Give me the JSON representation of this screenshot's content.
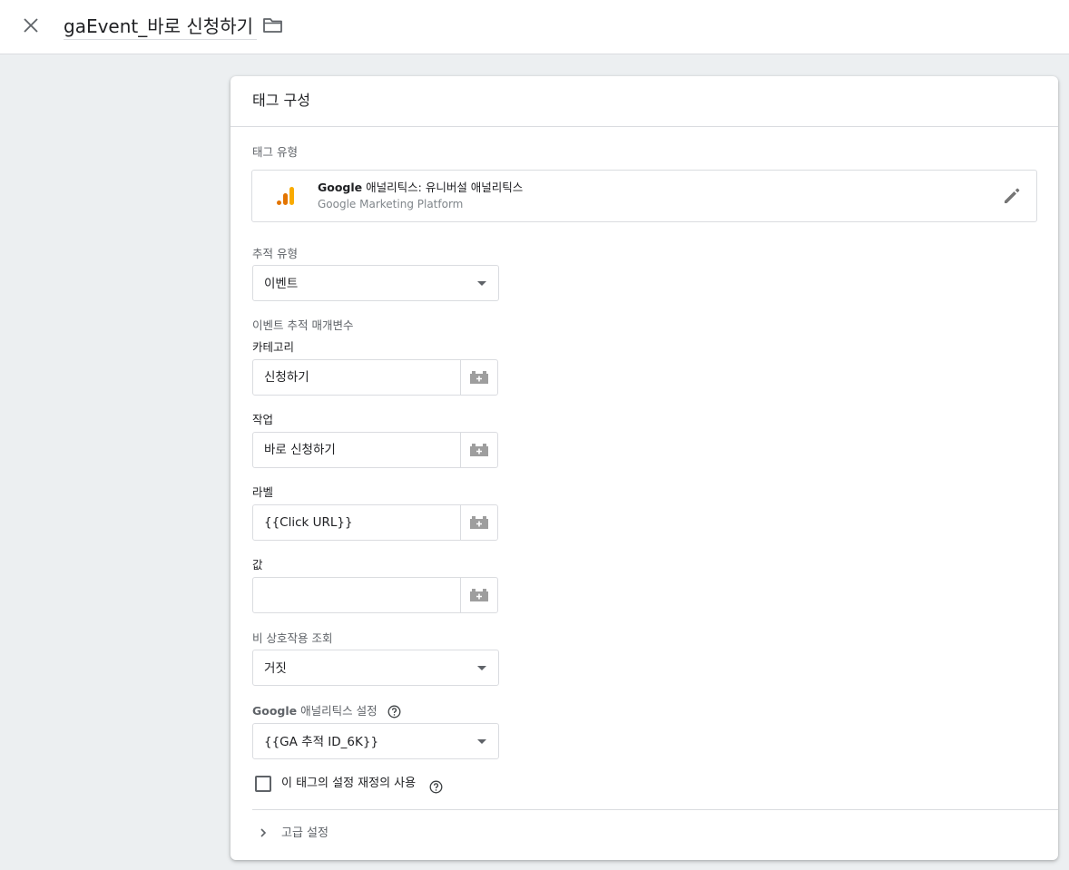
{
  "header": {
    "tag_name": "gaEvent_바로 신청하기",
    "close_icon": "close-icon",
    "folder_icon": "folder-icon"
  },
  "card": {
    "title": "태그 구성",
    "tag_type_label": "태그 유형",
    "tag_type": {
      "name_bold": "Google",
      "name_rest": " 애널리틱스: 유니버설 애널리틱스",
      "subtitle": "Google Marketing Platform",
      "icon": "analytics-icon",
      "edit_icon": "pencil-icon"
    },
    "track_type": {
      "label": "추적 유형",
      "value": "이벤트"
    },
    "event_params_label": "이벤트 추적 매개변수",
    "fields": {
      "category": {
        "label": "카테고리",
        "value": "신청하기"
      },
      "action": {
        "label": "작업",
        "value": "바로 신청하기"
      },
      "label": {
        "label": "라벨",
        "value": "{{Click URL}}"
      },
      "value": {
        "label": "값",
        "value": ""
      }
    },
    "non_interaction": {
      "label": "비 상호작용 조회",
      "value": "거짓"
    },
    "ga_settings": {
      "label_bold": "Google",
      "label_rest": " 애널리틱스 설정",
      "value": "{{GA 추적 ID_6K}}"
    },
    "override_checkbox": {
      "label": "이 태그의 설정 재정의 사용",
      "checked": false
    },
    "advanced": {
      "label": "고급 설정"
    }
  },
  "colors": {
    "background": "#eceff1",
    "analytics_orange": "#f9ab00",
    "analytics_dark_orange": "#e37400",
    "border": "#dadce0",
    "icon_gray": "#9e9e9e"
  }
}
